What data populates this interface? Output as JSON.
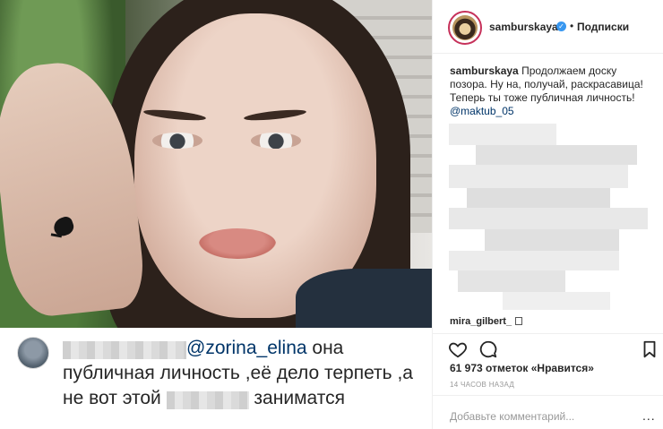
{
  "post": {
    "username": "samburskaya",
    "verified_mark": "✓",
    "separator": "•",
    "follow_label": "Подписки",
    "caption_text": "Продолжаем доску позора. Ну на, получай, раскрасавица! Теперь ты тоже публичная личность!",
    "caption_mention": "@maktub_05",
    "reply_user": "mira_gilbert_",
    "likes_text": "61 973 отметок «Нравится»",
    "time_ago": "14 ЧАСОВ НАЗАД",
    "add_comment_placeholder": "Добавьте комментарий...",
    "more_label": "..."
  },
  "screenshot_comment": {
    "mention": "@zorina_elina",
    "text_1": " она публичная личность ,её дело терпеть ,а не вот этой ",
    "text_2": " заниматся"
  },
  "icons": {
    "like": "heart-icon",
    "comment": "comment-bubble-icon",
    "save": "bookmark-icon",
    "verified": "verified-badge-icon"
  },
  "colors": {
    "text": "#262626",
    "link": "#003569",
    "muted": "#999999",
    "verified": "#3897f0",
    "story_ring": "#c6315a"
  }
}
